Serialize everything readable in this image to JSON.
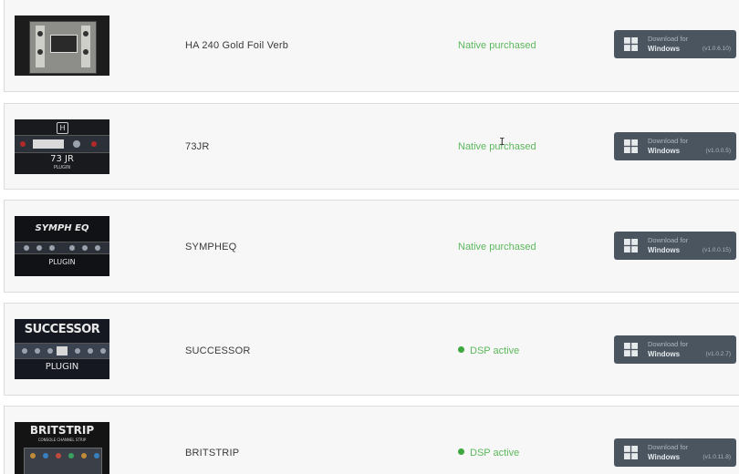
{
  "products": [
    {
      "name": "HA 240 Gold Foil Verb",
      "status": "Native purchased",
      "status_type": "purchased",
      "thumbnail": {
        "title": "",
        "subtitle": "",
        "icon": "hardware-reverb-photo"
      },
      "download": {
        "label": "Download for",
        "os": "Windows",
        "version": "(v1.0.6.10)"
      }
    },
    {
      "name": "73JR",
      "status": "Native purchased",
      "status_type": "purchased",
      "thumbnail": {
        "title": "73 JR",
        "subtitle": "PLUGIN",
        "icon": "rack-unit-h-logo"
      },
      "download": {
        "label": "Download for",
        "os": "Windows",
        "version": "(v1.0.0.5)"
      }
    },
    {
      "name": "SYMPHEQ",
      "status": "Native purchased",
      "status_type": "purchased",
      "thumbnail": {
        "title": "SYMPH EQ",
        "subtitle": "PLUGIN",
        "icon": "eq-rack"
      },
      "download": {
        "label": "Download for",
        "os": "Windows",
        "version": "(v1.0.0.15)"
      }
    },
    {
      "name": "SUCCESSOR",
      "status": "DSP active",
      "status_type": "active",
      "thumbnail": {
        "title": "SUCCESSOR",
        "subtitle": "PLUGIN",
        "icon": "compressor-rack"
      },
      "download": {
        "label": "Download for",
        "os": "Windows",
        "version": "(v1.0.2.7)"
      }
    },
    {
      "name": "BRITSTRIP",
      "status": "DSP active",
      "status_type": "active",
      "thumbnail": {
        "title": "BRITSTRIP",
        "subtitle": "CONSOLE CHANNEL STRIP",
        "icon": "channel-strip"
      },
      "download": {
        "label": "Download for",
        "os": "Windows",
        "version": "(v1.0.11.8)"
      }
    }
  ],
  "colors": {
    "purchased": "#5cb85c",
    "active_dot": "#3ea83e",
    "button": "#4a5560",
    "row_bg": "#f7f7f7"
  }
}
